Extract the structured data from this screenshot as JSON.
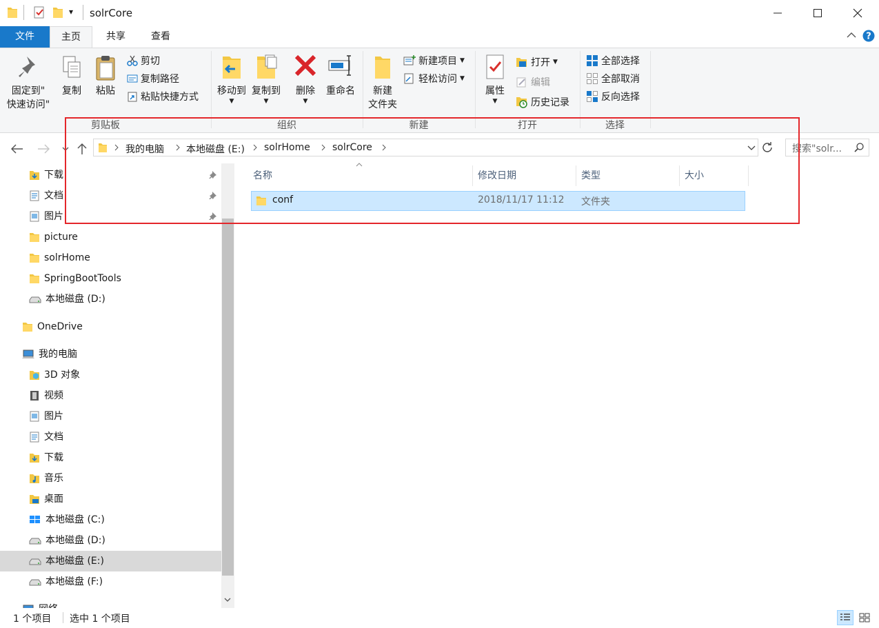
{
  "window": {
    "title": "solrCore",
    "qa_dropdown": "▾"
  },
  "tabs": [
    "文件",
    "主页",
    "共享",
    "查看"
  ],
  "ribbon": {
    "clipboard": {
      "label": "剪贴板",
      "pin_line1": "固定到\"",
      "pin_line2": "快速访问\"",
      "copy": "复制",
      "paste": "粘贴",
      "cut": "剪切",
      "copy_path": "复制路径",
      "paste_shortcut": "粘贴快捷方式"
    },
    "organize": {
      "label": "组织",
      "move_to": "移动到",
      "copy_to": "复制到",
      "delete": "删除",
      "rename": "重命名"
    },
    "new": {
      "label": "新建",
      "new_folder_line1": "新建",
      "new_folder_line2": "文件夹",
      "new_item": "新建项目",
      "easy_access": "轻松访问"
    },
    "open": {
      "label": "打开",
      "properties": "属性",
      "open": "打开",
      "edit": "编辑",
      "history": "历史记录"
    },
    "select": {
      "label": "选择",
      "select_all": "全部选择",
      "select_none": "全部取消",
      "invert": "反向选择"
    }
  },
  "address": {
    "crumbs": [
      "我的电脑",
      "本地磁盘 (E:)",
      "solrHome",
      "solrCore"
    ],
    "search_placeholder": "搜索\"solr..."
  },
  "navpane": {
    "items": [
      {
        "label": "下载",
        "pinned": true
      },
      {
        "label": "文档",
        "pinned": true
      },
      {
        "label": "图片",
        "pinned": true
      },
      {
        "label": "picture"
      },
      {
        "label": "solrHome"
      },
      {
        "label": "SpringBootTools"
      },
      {
        "label": "本地磁盘 (D:)"
      },
      {
        "label": "OneDrive"
      },
      {
        "label": "我的电脑"
      },
      {
        "label": "3D 对象"
      },
      {
        "label": "视频"
      },
      {
        "label": "图片"
      },
      {
        "label": "文档"
      },
      {
        "label": "下载"
      },
      {
        "label": "音乐"
      },
      {
        "label": "桌面"
      },
      {
        "label": "本地磁盘 (C:)"
      },
      {
        "label": "本地磁盘 (D:)"
      },
      {
        "label": "本地磁盘 (E:)",
        "selected": true
      },
      {
        "label": "本地磁盘 (F:)"
      },
      {
        "label": "网络"
      }
    ]
  },
  "columns": {
    "name": "名称",
    "modified": "修改日期",
    "type": "类型",
    "size": "大小"
  },
  "files": [
    {
      "name": "conf",
      "modified": "2018/11/17 11:12",
      "type": "文件夹",
      "size": ""
    }
  ],
  "status": {
    "count": "1 个项目",
    "selected": "选中 1 个项目"
  },
  "colors": {
    "accent": "#1979ca",
    "highlight_box": "#e4262a",
    "selection": "#cce8ff"
  }
}
